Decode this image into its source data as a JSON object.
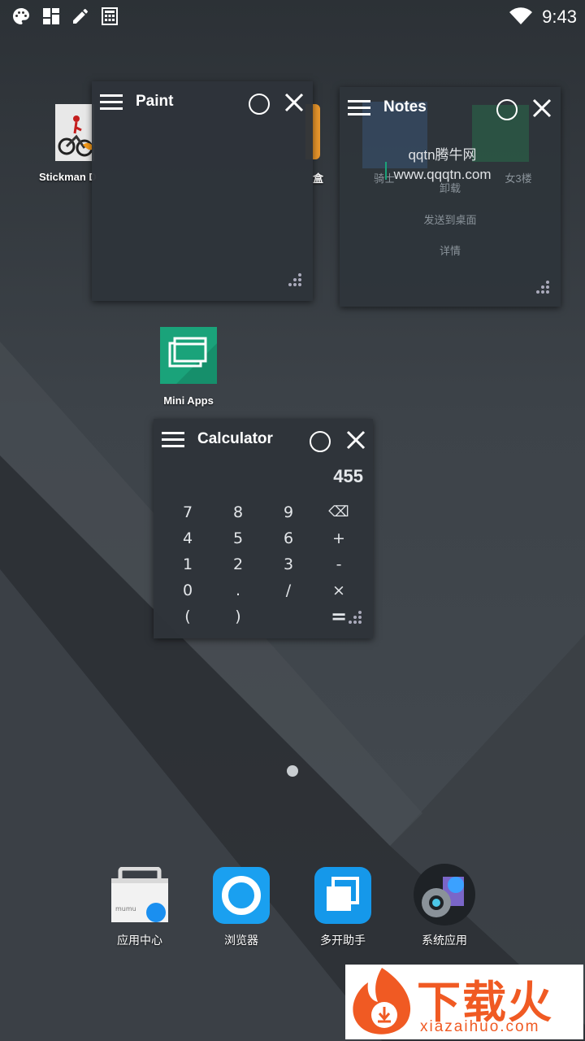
{
  "statusbar": {
    "icons": [
      "palette-icon",
      "dashboard-icon",
      "pencil-icon",
      "calculator-icon"
    ],
    "wifi_icon": "wifi-icon",
    "time": "9:43"
  },
  "desktop": {
    "apps": [
      {
        "label": "Stickman D",
        "icon": "stickman-game-icon"
      },
      {
        "label": "Mini Apps",
        "icon": "mini-apps-icon"
      }
    ],
    "partial_label_behind_paint": "盒"
  },
  "paint_window": {
    "title": "Paint"
  },
  "notes_window": {
    "title": "Notes",
    "ghost_items": [
      "骑士",
      "卸载",
      "发送到桌面",
      "详情",
      "女3楼"
    ]
  },
  "watermark": {
    "line1": "qqtn腾牛网",
    "line2": "www.qqqtn.com"
  },
  "calculator_window": {
    "title": "Calculator",
    "display": "455",
    "keys": [
      [
        "7",
        "8",
        "9",
        "⌫"
      ],
      [
        "4",
        "5",
        "6",
        "+"
      ],
      [
        "1",
        "2",
        "3",
        "-"
      ],
      [
        "0",
        ".",
        "/",
        "×"
      ],
      [
        "(",
        ")",
        "",
        "="
      ]
    ]
  },
  "dock": [
    {
      "label": "应用中心",
      "icon": "app-center-icon"
    },
    {
      "label": "浏览器",
      "icon": "browser-icon"
    },
    {
      "label": "多开助手",
      "icon": "multi-open-icon"
    },
    {
      "label": "系统应用",
      "icon": "system-apps-icon"
    }
  ],
  "brand": {
    "name": "下载火",
    "url": "xiazaihuo.com"
  },
  "colors": {
    "accent_green": "#1aa37a",
    "browser_blue": "#1aa0f0",
    "brand_orange": "#f05a23"
  }
}
